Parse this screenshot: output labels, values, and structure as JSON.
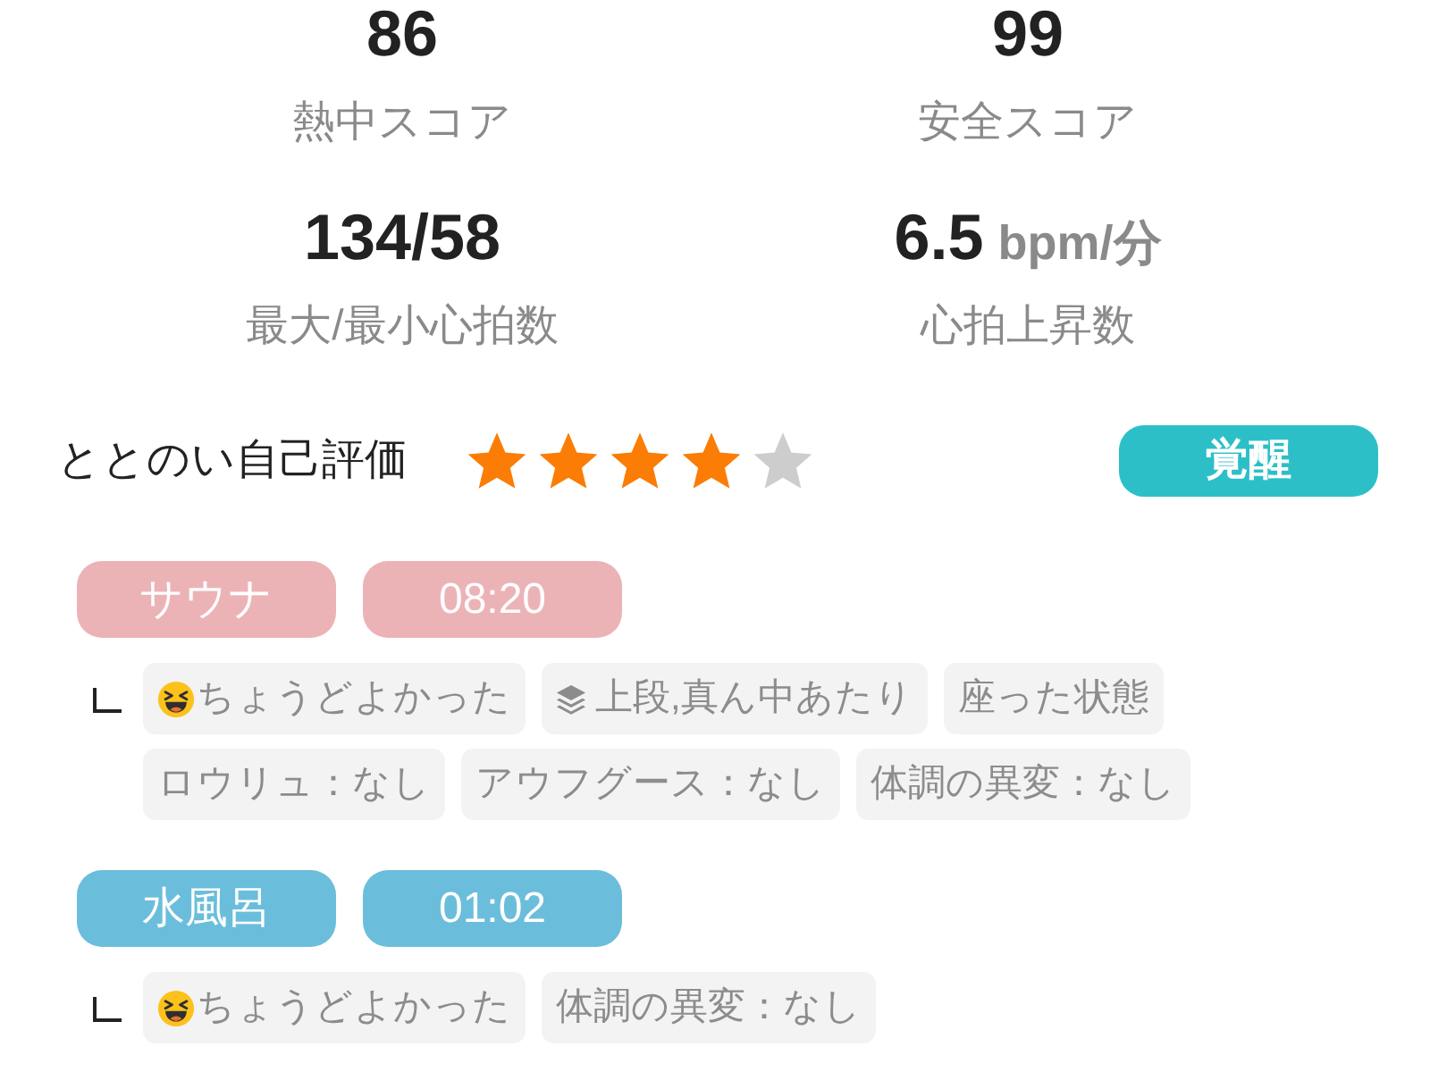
{
  "metrics": [
    {
      "value": "86",
      "label": "熱中スコア"
    },
    {
      "value": "99",
      "label": "安全スコア"
    },
    {
      "value": "134/58",
      "label": "最大/最小心拍数"
    },
    {
      "value": "6.5",
      "unit": "bpm/分",
      "label": "心拍上昇数"
    }
  ],
  "rating": {
    "label": "ととのい自己評価",
    "stars": 4,
    "badge": "覚醒"
  },
  "sessions": [
    {
      "name": "サウナ",
      "duration": "08:20",
      "color": "#ecb3b7",
      "tags": [
        {
          "kind": "feeling",
          "text": "ちょうどよかった"
        },
        {
          "kind": "position",
          "text": "上段,真ん中あたり"
        },
        {
          "kind": "plain",
          "text": "座った状態"
        },
        {
          "kind": "plain",
          "text": "ロウリュ：なし"
        },
        {
          "kind": "plain",
          "text": "アウフグース：なし"
        },
        {
          "kind": "plain",
          "text": "体調の異変：なし"
        }
      ]
    },
    {
      "name": "水風呂",
      "duration": "01:02",
      "color": "#6bbedb",
      "tags": [
        {
          "kind": "feeling",
          "text": "ちょうどよかった"
        },
        {
          "kind": "plain",
          "text": "体調の異変：なし"
        }
      ]
    }
  ]
}
